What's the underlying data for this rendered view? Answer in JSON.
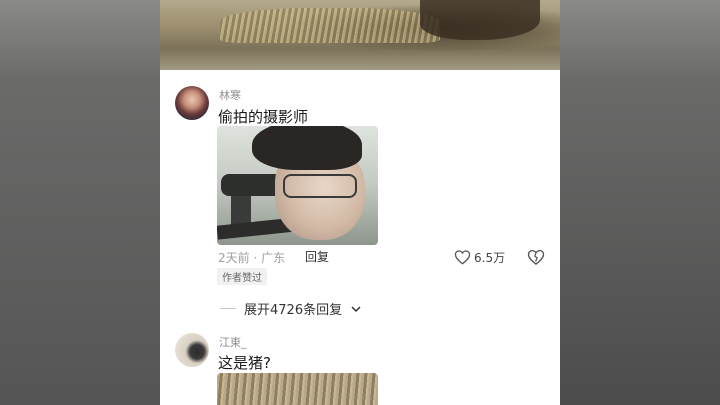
{
  "comments": [
    {
      "username": "林寒",
      "text": "偷拍的摄影师",
      "time_location": "2天前 · 广东",
      "reply_label": "回复",
      "likes": "6.5万",
      "badge": "作者赞过",
      "expand_label": "展开4726条回复"
    },
    {
      "username": "江東_",
      "text": "这是猪?"
    }
  ],
  "icons": {
    "like": "heart-outline-icon",
    "dislike": "broken-heart-icon",
    "expand": "chevron-down-icon"
  },
  "colors": {
    "username": "#8f8f8f",
    "meta": "#a0a0a0",
    "text": "#1a1a1a",
    "background": "#ffffff"
  }
}
